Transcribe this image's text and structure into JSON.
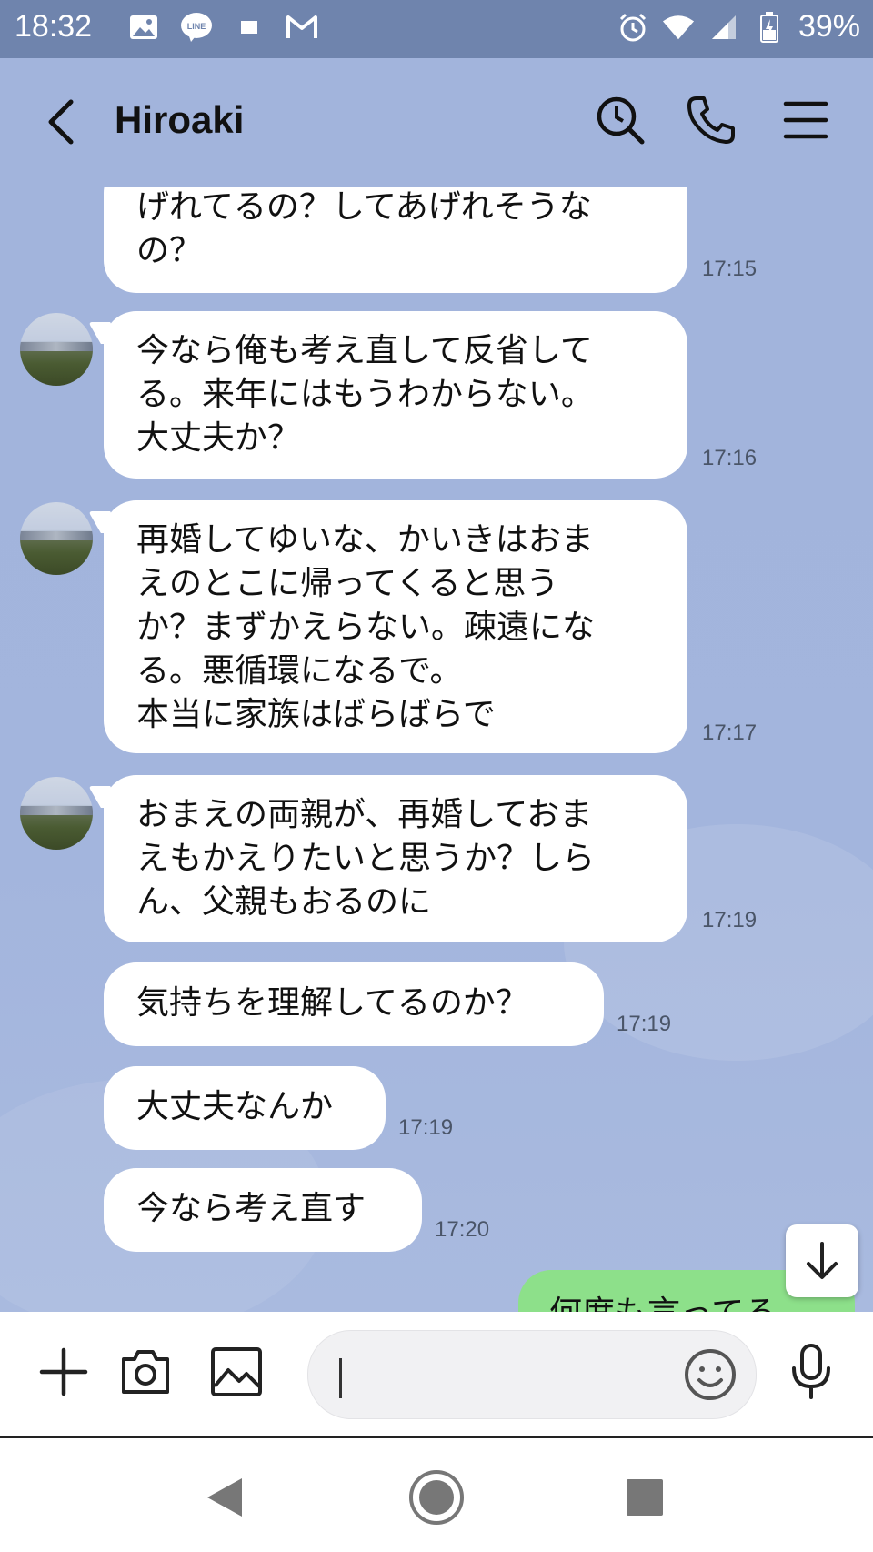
{
  "status_bar": {
    "time": "18:32",
    "battery": "39%",
    "left_icons": [
      "image-icon",
      "line-icon",
      "square-icon",
      "gmail-icon"
    ],
    "right_icons": [
      "alarm-icon",
      "wifi-icon",
      "signal-icon",
      "battery-icon"
    ]
  },
  "header": {
    "title": "Hiroaki"
  },
  "messages": [
    {
      "text": "げれてるの？してあげれそうな\nの？",
      "time": "17:15"
    },
    {
      "text": "今なら俺も考え直して反省して\nる。来年にはもうわからない。\n大丈夫か？",
      "time": "17:16"
    },
    {
      "text": "再婚してゆいな、かいきはおま\nえのとこに帰ってくると思う\nか？まずかえらない。疎遠にな\nる。悪循環になるで。\n本当に家族はばらばらで",
      "time": "17:17"
    },
    {
      "text": "おまえの両親が、再婚しておま\nえもかえりたいと思うか？しら\nん、父親もおるのに",
      "time": "17:19"
    },
    {
      "text": "気持ちを理解してるのか？",
      "time": "17:19"
    },
    {
      "text": "大丈夫なんか",
      "time": "17:19"
    },
    {
      "text": "今なら考え直す",
      "time": "17:20"
    }
  ],
  "own_message_partial": "何度も言ってる",
  "input": {
    "placeholder": ""
  },
  "colors": {
    "chat_background": "#a2b4dc",
    "status_bar": "#6f84ad",
    "incoming_bubble": "#ffffff",
    "outgoing_bubble": "#8de08a"
  }
}
